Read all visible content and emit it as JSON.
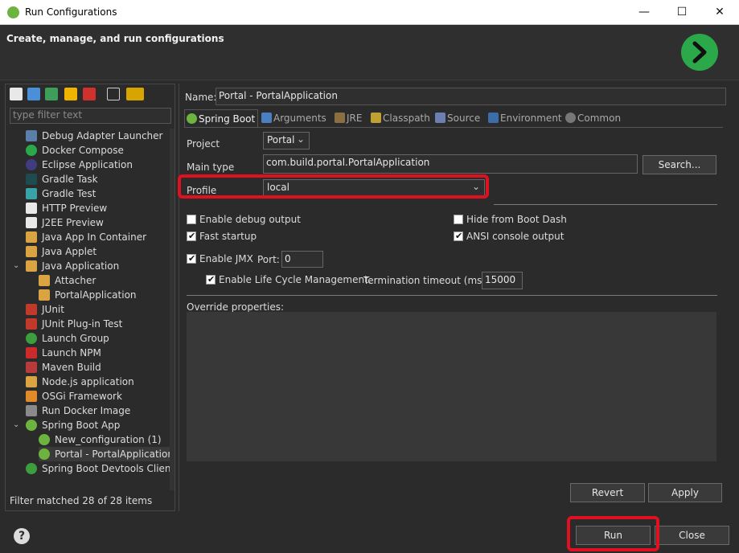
{
  "window": {
    "title": "Run Configurations",
    "minimize": "—",
    "maximize": "☐",
    "close": "✕"
  },
  "header": {
    "title": "Create, manage, and run configurations"
  },
  "left": {
    "filter_placeholder": "type filter text",
    "tree": [
      {
        "label": "Debug Adapter Launcher",
        "icon": "debug-adapter-icon"
      },
      {
        "label": "Docker Compose",
        "icon": "docker-compose-icon"
      },
      {
        "label": "Eclipse Application",
        "icon": "eclipse-icon"
      },
      {
        "label": "Gradle Task",
        "icon": "gradle-icon"
      },
      {
        "label": "Gradle Test",
        "icon": "gradle-icon"
      },
      {
        "label": "HTTP Preview",
        "icon": "preview-icon"
      },
      {
        "label": "J2EE Preview",
        "icon": "preview-icon"
      },
      {
        "label": "Java App In Container",
        "icon": "java-icon"
      },
      {
        "label": "Java Applet",
        "icon": "java-icon"
      },
      {
        "label": "Java Application",
        "icon": "java-icon"
      },
      {
        "label": "Attacher",
        "icon": "java-icon"
      },
      {
        "label": "PortalApplication",
        "icon": "java-icon"
      },
      {
        "label": "JUnit",
        "icon": "junit-icon"
      },
      {
        "label": "JUnit Plug-in Test",
        "icon": "junit-icon"
      },
      {
        "label": "Launch Group",
        "icon": "launch-group-icon"
      },
      {
        "label": "Launch NPM",
        "icon": "npm-icon"
      },
      {
        "label": "Maven Build",
        "icon": "maven-icon"
      },
      {
        "label": "Node.js application",
        "icon": "nodejs-icon"
      },
      {
        "label": "OSGi Framework",
        "icon": "osgi-icon"
      },
      {
        "label": "Run Docker Image",
        "icon": "docker-icon"
      },
      {
        "label": "Spring Boot App",
        "icon": "spring-icon"
      },
      {
        "label": "New_configuration (1)",
        "icon": "spring-icon"
      },
      {
        "label": "Portal - PortalApplication",
        "icon": "spring-icon"
      },
      {
        "label": "Spring Boot Devtools Client",
        "icon": "spring-devtools-icon"
      }
    ],
    "status": "Filter matched 28 of 28 items",
    "expanded_arrow": "⌄"
  },
  "config": {
    "name_label": "Name:",
    "name_value": "Portal - PortalApplication",
    "tabs": [
      "Spring Boot",
      "Arguments",
      "JRE",
      "Classpath",
      "Source",
      "Environment",
      "Common"
    ],
    "project_label": "Project",
    "project_value": "Portal",
    "main_type_label": "Main type",
    "main_type_value": "com.build.portal.PortalApplication",
    "search_button": "Search...",
    "profile_label": "Profile",
    "profile_value": "local",
    "chevron": "⌄",
    "enable_debug_output": "Enable debug output",
    "hide_from_boot_dash": "Hide from Boot Dash",
    "fast_startup": "Fast startup",
    "ansi_console_output": "ANSI console output",
    "enable_jmx": "Enable JMX",
    "port_label": "Port:",
    "port_value": "0",
    "enable_lifecycle": "Enable Life Cycle Management.",
    "termination_timeout_label": "Termination timeout (ms):",
    "termination_timeout_value": "15000",
    "override_label": "Override properties:",
    "revert_button": "Revert",
    "apply_button": "Apply"
  },
  "footer": {
    "help": "?",
    "run_button": "Run",
    "close_button": "Close"
  },
  "colors": {
    "highlight": "#e01020",
    "run_green": "#2ba84a",
    "spring_green": "#6db33f"
  }
}
